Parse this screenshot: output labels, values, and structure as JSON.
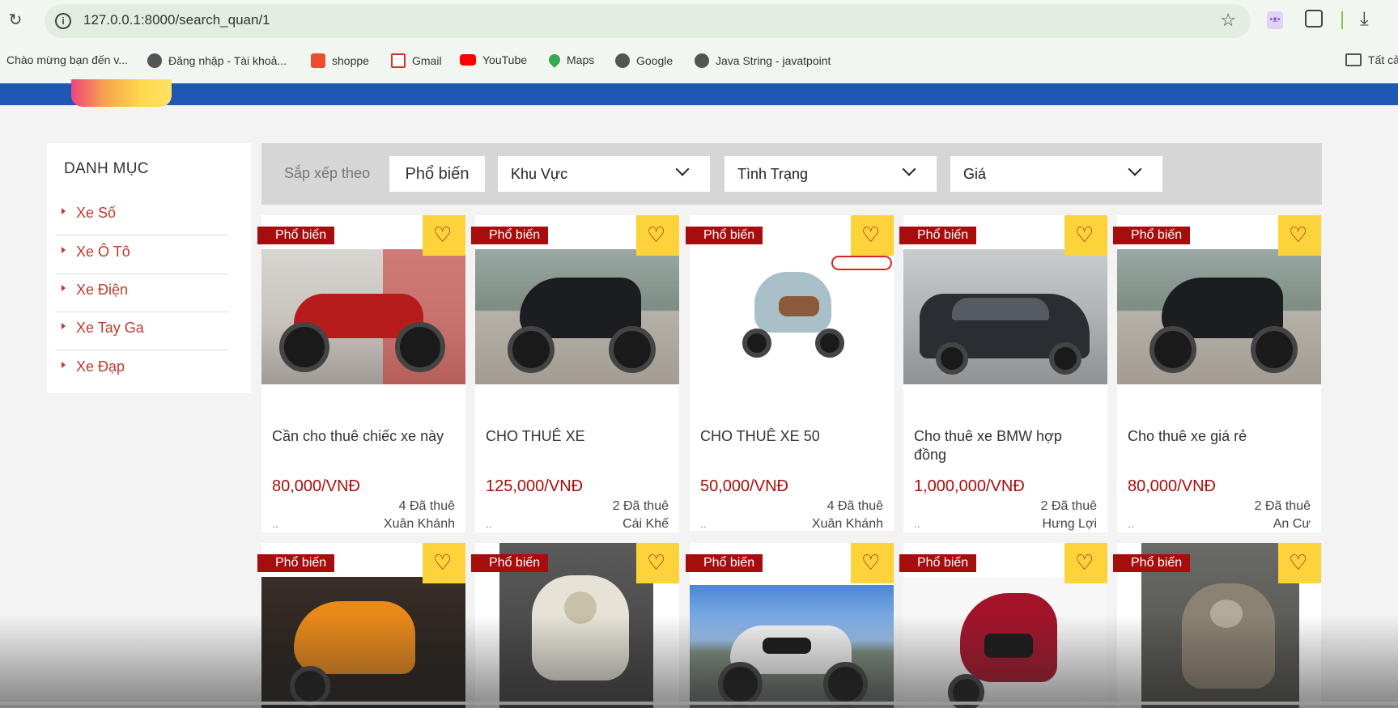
{
  "browser": {
    "url": "127.0.0.1:8000/search_quan/1",
    "bookmarks": [
      "Chào mừng bạn đến v...",
      "Đăng nhập - Tài khoả...",
      "shoppe",
      "Gmail",
      "YouTube",
      "Maps",
      "Google",
      "Java String - javatpoint",
      "Tất cả"
    ]
  },
  "sidebar": {
    "title": "DANH MỤC",
    "categories": [
      "Xe Số",
      "Xe Ô Tô",
      "Xe Điện",
      "Xe Tay Ga",
      "Xe Đạp"
    ]
  },
  "sortbar": {
    "label": "Sắp xếp theo",
    "popular_button": "Phổ biến",
    "area_select": "Khu Vực",
    "status_select": "Tình Trạng",
    "price_select": "Giá"
  },
  "products": [
    {
      "badge": "Phổ biến",
      "title": "Cần cho thuê chiếc xe này",
      "price": "80,000/VNĐ",
      "rented": "4 Đã thuê",
      "dots": "..",
      "area": "Xuân Khánh",
      "image": "red-motorbike"
    },
    {
      "badge": "Phổ biến",
      "title": "CHO THUÊ XE",
      "price": "125,000/VNĐ",
      "rented": "2 Đã thuê",
      "dots": "..",
      "area": "Cái Khế",
      "image": "black-scooter"
    },
    {
      "badge": "Phổ biến",
      "title": "CHO THUÊ XE 50",
      "price": "50,000/VNĐ",
      "rented": "4 Đã thuê",
      "dots": "..",
      "area": "Xuân Khánh",
      "image": "blue-scooter"
    },
    {
      "badge": "Phổ biến",
      "title": "Cho thuê xe BMW hợp đồng",
      "price": "1,000,000/VNĐ",
      "rented": "2 Đã thuê",
      "dots": "..",
      "area": "Hưng Lợi",
      "image": "black-bmw-car"
    },
    {
      "badge": "Phổ biến",
      "title": "Cho thuê xe giá rẻ",
      "price": "80,000/VNĐ",
      "rented": "2 Đã thuê",
      "dots": "..",
      "area": "An Cư",
      "image": "black-scooter"
    },
    {
      "badge": "Phổ biến",
      "image": "orange-vespa"
    },
    {
      "badge": "Phổ biến",
      "image": "cream-scooter"
    },
    {
      "badge": "Phổ biến",
      "image": "white-motorbike"
    },
    {
      "badge": "Phổ biến",
      "image": "red-scooter"
    },
    {
      "badge": "Phổ biến",
      "image": "grey-vespa"
    }
  ],
  "colors": {
    "accent_red": "#a80d0d",
    "badge_yellow": "#fcd33b",
    "header_blue": "#1e57b4"
  }
}
